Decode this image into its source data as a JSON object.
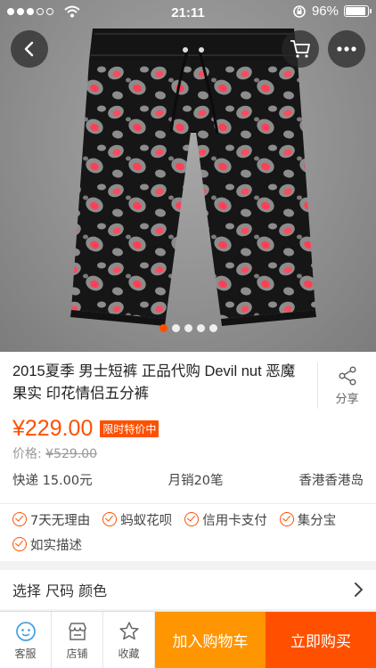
{
  "status_bar": {
    "time": "21:11",
    "battery_percent": "96%",
    "battery_level": 0.96
  },
  "hero": {
    "image_count": 5,
    "active_index": 0,
    "back_icon": "chevron-left-icon",
    "cart_icon": "cart-icon",
    "more_icon": "more-dots-icon"
  },
  "product": {
    "title": "2015夏季 男士短裤 正品代购 Devil nut 恶魔果实 印花情侣五分裤",
    "share_label": "分享",
    "price": "¥229.00",
    "price_tag": "限时特价中",
    "original_price_label": "价格:",
    "original_price": "¥529.00",
    "shipping": "快递 15.00元",
    "monthly_sales": "月销20笔",
    "location": "香港香港岛"
  },
  "services": [
    "7天无理由",
    "蚂蚁花呗",
    "信用卡支付",
    "集分宝",
    "如实描述"
  ],
  "select_row": {
    "label": "选择 尺码 颜色"
  },
  "bottom_bar": {
    "tabs": [
      {
        "label": "客服",
        "icon": "customer-service-icon"
      },
      {
        "label": "店铺",
        "icon": "shop-icon"
      },
      {
        "label": "收藏",
        "icon": "star-icon"
      }
    ],
    "add_to_cart": "加入购物车",
    "buy_now": "立即购买"
  },
  "colors": {
    "accent": "#ff5000",
    "cart_button": "#ff9500"
  }
}
